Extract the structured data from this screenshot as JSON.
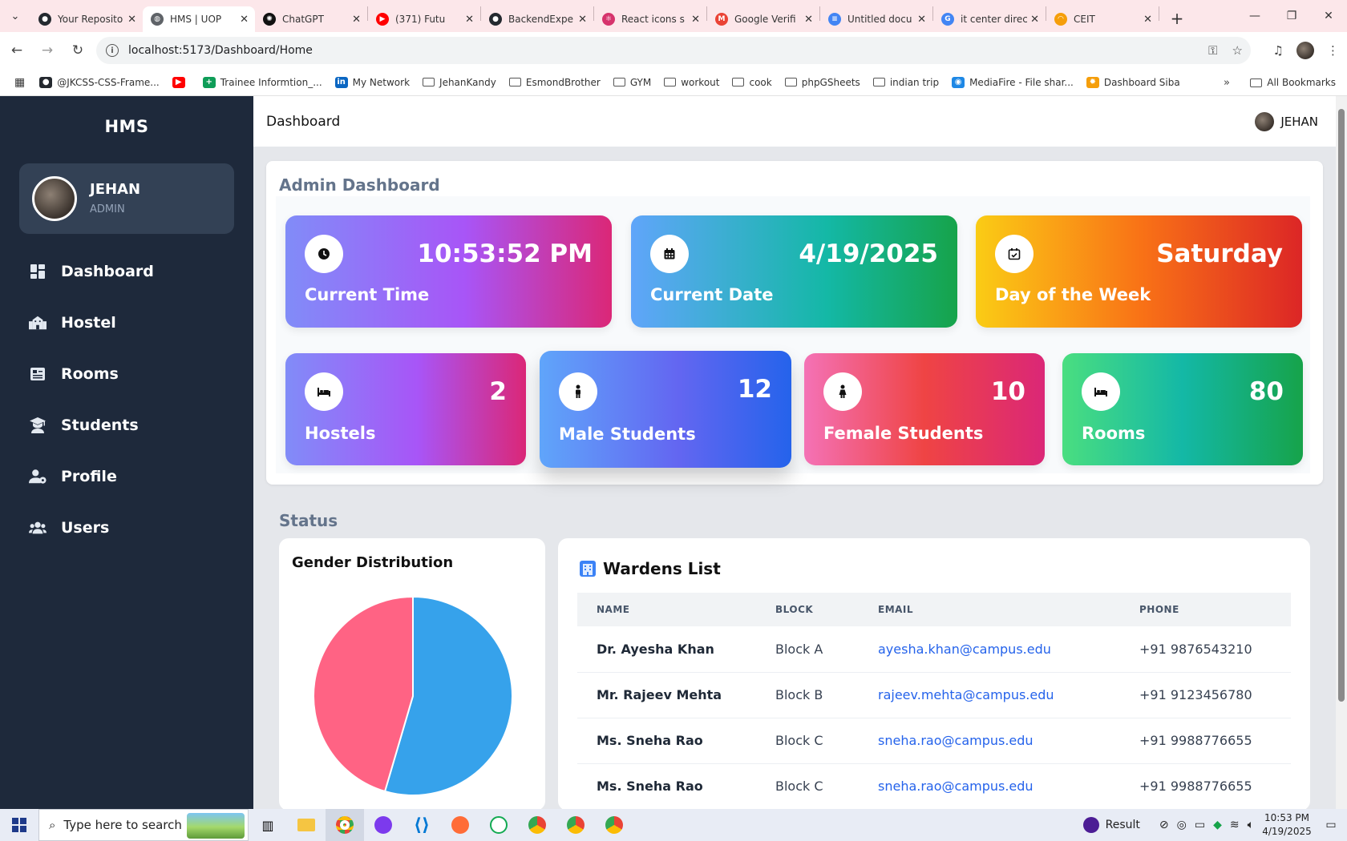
{
  "browser": {
    "tabs": [
      {
        "label": "Your Reposito",
        "icon": "github-icon",
        "active": false
      },
      {
        "label": "HMS | UOP",
        "icon": "globe-icon",
        "active": true
      },
      {
        "label": "ChatGPT",
        "icon": "chatgpt-icon",
        "active": false
      },
      {
        "label": "(371) Futu",
        "icon": "youtube-icon",
        "active": false
      },
      {
        "label": "BackendExpe",
        "icon": "github-icon",
        "active": false
      },
      {
        "label": "React icons s",
        "icon": "react-icon",
        "active": false
      },
      {
        "label": "Google Verifi",
        "icon": "gmail-icon",
        "active": false
      },
      {
        "label": "Untitled docu",
        "icon": "docs-icon",
        "active": false
      },
      {
        "label": "it center direc",
        "icon": "google-icon",
        "active": false
      },
      {
        "label": "CEIT",
        "icon": "ceit-icon",
        "active": false
      }
    ],
    "url": "localhost:5173/Dashboard/Home",
    "bookmarks": [
      {
        "label": "@JKCSS-CSS-Frame...",
        "icon": "github-icon"
      },
      {
        "label": "",
        "icon": "youtube-icon"
      },
      {
        "label": "Trainee Informtion_...",
        "icon": "sheets-icon"
      },
      {
        "label": "My Network",
        "icon": "linkedin-icon"
      },
      {
        "label": "JehanKandy",
        "icon": "folder-icon"
      },
      {
        "label": "EsmondBrother",
        "icon": "folder-icon"
      },
      {
        "label": "GYM",
        "icon": "folder-icon"
      },
      {
        "label": "workout",
        "icon": "folder-icon"
      },
      {
        "label": "cook",
        "icon": "folder-icon"
      },
      {
        "label": "phpGSheets",
        "icon": "folder-icon"
      },
      {
        "label": "indian trip",
        "icon": "folder-icon"
      },
      {
        "label": "MediaFire - File shar...",
        "icon": "mediafire-icon"
      },
      {
        "label": "Dashboard Siba",
        "icon": "sun-icon"
      }
    ],
    "all_bookmarks": "All Bookmarks"
  },
  "sidebar": {
    "brand": "HMS",
    "user": {
      "name": "JEHAN",
      "role": "ADMIN"
    },
    "items": [
      {
        "label": "Dashboard",
        "icon": "dashboard-icon"
      },
      {
        "label": "Hostel",
        "icon": "hostel-icon"
      },
      {
        "label": "Rooms",
        "icon": "rooms-icon"
      },
      {
        "label": "Students",
        "icon": "students-icon"
      },
      {
        "label": "Profile",
        "icon": "profile-icon"
      },
      {
        "label": "Users",
        "icon": "users-icon"
      }
    ]
  },
  "header": {
    "title": "Dashboard",
    "user": "JEHAN"
  },
  "admin": {
    "title": "Admin Dashboard",
    "info_cards": [
      {
        "value": "10:53:52 PM",
        "label": "Current Time",
        "icon": "clock-icon"
      },
      {
        "value": "4/19/2025",
        "label": "Current Date",
        "icon": "calendar-icon"
      },
      {
        "value": "Saturday",
        "label": "Day of the Week",
        "icon": "calendar-check-icon"
      }
    ],
    "stat_cards": [
      {
        "value": "2",
        "label": "Hostels",
        "icon": "bed-icon"
      },
      {
        "value": "12",
        "label": "Male Students",
        "icon": "male-icon"
      },
      {
        "value": "10",
        "label": "Female Students",
        "icon": "female-icon"
      },
      {
        "value": "80",
        "label": "Rooms",
        "icon": "bed-icon"
      }
    ]
  },
  "status": {
    "title": "Status",
    "gender_chart": {
      "title": "Gender Distribution"
    },
    "wardens": {
      "title": "Wardens List",
      "columns": [
        "NAME",
        "BLOCK",
        "EMAIL",
        "PHONE"
      ],
      "rows": [
        [
          "Dr. Ayesha Khan",
          "Block A",
          "ayesha.khan@campus.edu",
          "+91 9876543210"
        ],
        [
          "Mr. Rajeev Mehta",
          "Block B",
          "rajeev.mehta@campus.edu",
          "+91 9123456780"
        ],
        [
          "Ms. Sneha Rao",
          "Block C",
          "sneha.rao@campus.edu",
          "+91 9988776655"
        ],
        [
          "Ms. Sneha Rao",
          "Block C",
          "sneha.rao@campus.edu",
          "+91 9988776655"
        ]
      ]
    }
  },
  "chart_data": {
    "type": "pie",
    "title": "Gender Distribution",
    "categories": [
      "",
      ""
    ],
    "values": [
      12,
      10
    ],
    "colors": [
      "#36a2eb",
      "#ff6384"
    ]
  },
  "taskbar": {
    "search_placeholder": "Type here to search",
    "result_label": "Result",
    "time": "10:53 PM",
    "date": "4/19/2025"
  },
  "colors": {
    "sidebar": "#1e293b",
    "accent_link": "#2563eb",
    "male": "#36a2eb",
    "female": "#ff6384"
  }
}
